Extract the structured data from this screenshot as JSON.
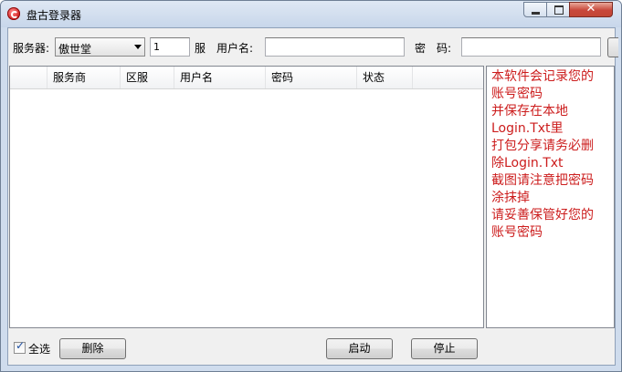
{
  "window": {
    "title": "盘古登录器"
  },
  "form": {
    "server_label": "服务器:",
    "server_value": "傲世堂",
    "zone_value": "1",
    "zone_suffix": "服",
    "username_label": "用户名:",
    "username_value": "",
    "password_label": "密　码:",
    "password_value": ""
  },
  "table": {
    "columns": [
      "",
      "服务商",
      "区服",
      "用户名",
      "密码",
      "状态"
    ],
    "rows": []
  },
  "notice_lines": [
    "本软件会记录您的",
    "账号密码",
    "并保存在本地",
    "Login.Txt里",
    "打包分享请务必删",
    "除Login.Txt",
    "截图请注意把密码",
    "涂抹掉",
    "请妥善保管好您的",
    "账号密码"
  ],
  "footer": {
    "select_all_label": "全选",
    "select_all_checked": true,
    "delete_label": "删除",
    "start_label": "启动",
    "stop_label": "停止"
  },
  "colors": {
    "notice_text": "#cc1d1d",
    "title_bar": "#c7d6ea",
    "close_button": "#c8473a"
  }
}
